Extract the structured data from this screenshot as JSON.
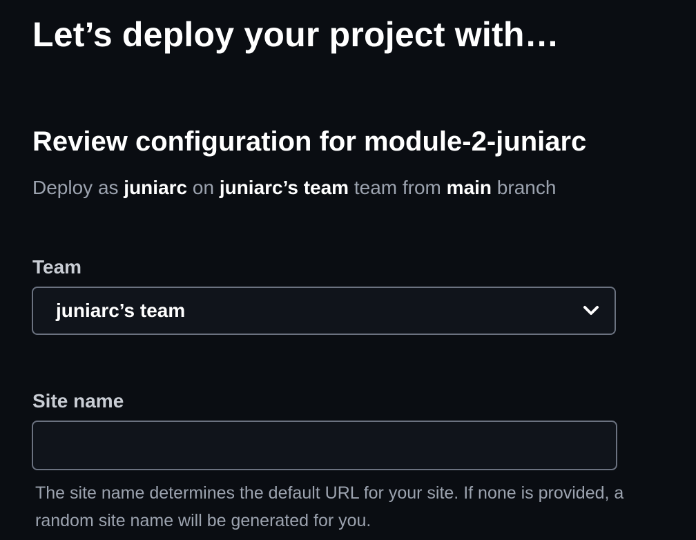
{
  "header": {
    "title": "Let’s deploy your project with…"
  },
  "review": {
    "title": "Review configuration for module-2-juniarc",
    "subtitle": {
      "prefix": "Deploy as ",
      "user": "juniarc",
      "on": " on ",
      "team": "juniarc’s team",
      "team_suffix": " team from ",
      "branch": "main",
      "branch_suffix": " branch"
    }
  },
  "team_field": {
    "label": "Team",
    "selected": "juniarc’s team",
    "icon": "chevron-down-icon"
  },
  "site_name_field": {
    "label": "Site name",
    "value": "",
    "placeholder": "",
    "help": "The site name determines the default URL for your site. If none is provided, a random site name will be generated for you."
  },
  "colors": {
    "background": "#0a0d12",
    "input_background": "#10141b",
    "input_border": "#6b7280",
    "muted_text": "#9ca3af",
    "label_text": "#c9cdd4",
    "text": "#ffffff"
  }
}
